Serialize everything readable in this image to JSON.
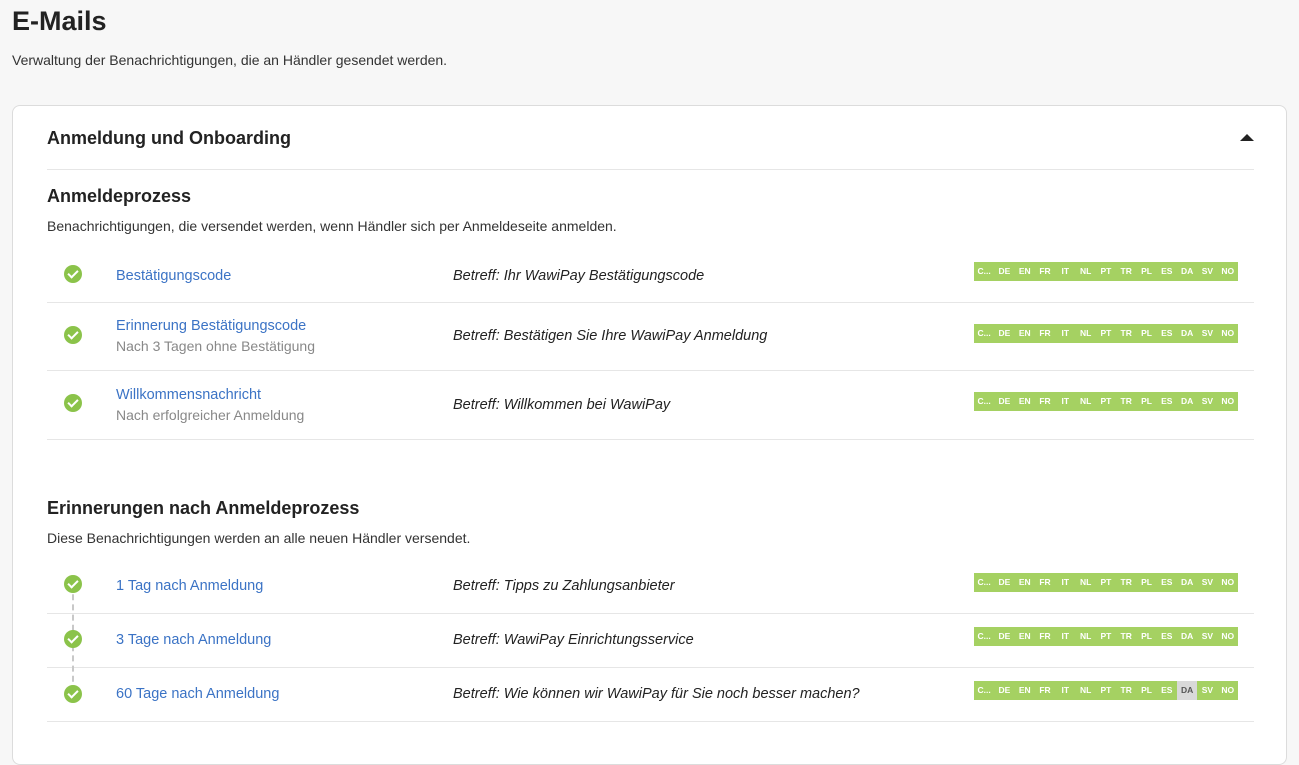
{
  "page": {
    "title": "E-Mails",
    "description": "Verwaltung der Benachrichtigungen, die an Händler gesendet werden."
  },
  "card": {
    "title": "Anmeldung und Onboarding",
    "collapse_icon": "caret-up-icon"
  },
  "colors": {
    "check": "#8bc34a",
    "lang_active": "#a5d162",
    "lang_inactive": "#d9d9d9",
    "link": "#3b73c5"
  },
  "sections": [
    {
      "title": "Anmeldeprozess",
      "description": "Benachrichtigungen, die versendet werden, wenn Händler sich per Anmeldeseite anmelden.",
      "rows": [
        {
          "name": "Bestätigungscode",
          "sub": "",
          "subject": "Betreff: Ihr WawiPay Bestätigungscode",
          "langs": [
            {
              "code": "C...",
              "active": true
            },
            {
              "code": "DE",
              "active": true
            },
            {
              "code": "EN",
              "active": true
            },
            {
              "code": "FR",
              "active": true
            },
            {
              "code": "IT",
              "active": true
            },
            {
              "code": "NL",
              "active": true
            },
            {
              "code": "PT",
              "active": true
            },
            {
              "code": "TR",
              "active": true
            },
            {
              "code": "PL",
              "active": true
            },
            {
              "code": "ES",
              "active": true
            },
            {
              "code": "DA",
              "active": true
            },
            {
              "code": "SV",
              "active": true
            },
            {
              "code": "NO",
              "active": true
            }
          ]
        },
        {
          "name": "Erinnerung Bestätigungscode",
          "sub": "Nach 3 Tagen ohne Bestätigung",
          "subject": "Betreff: Bestätigen Sie Ihre WawiPay Anmeldung",
          "langs": [
            {
              "code": "C...",
              "active": true
            },
            {
              "code": "DE",
              "active": true
            },
            {
              "code": "EN",
              "active": true
            },
            {
              "code": "FR",
              "active": true
            },
            {
              "code": "IT",
              "active": true
            },
            {
              "code": "NL",
              "active": true
            },
            {
              "code": "PT",
              "active": true
            },
            {
              "code": "TR",
              "active": true
            },
            {
              "code": "PL",
              "active": true
            },
            {
              "code": "ES",
              "active": true
            },
            {
              "code": "DA",
              "active": true
            },
            {
              "code": "SV",
              "active": true
            },
            {
              "code": "NO",
              "active": true
            }
          ]
        },
        {
          "name": "Willkommensnachricht",
          "sub": "Nach erfolgreicher Anmeldung",
          "subject": "Betreff: Willkommen bei WawiPay",
          "langs": [
            {
              "code": "C...",
              "active": true
            },
            {
              "code": "DE",
              "active": true
            },
            {
              "code": "EN",
              "active": true
            },
            {
              "code": "FR",
              "active": true
            },
            {
              "code": "IT",
              "active": true
            },
            {
              "code": "NL",
              "active": true
            },
            {
              "code": "PT",
              "active": true
            },
            {
              "code": "TR",
              "active": true
            },
            {
              "code": "PL",
              "active": true
            },
            {
              "code": "ES",
              "active": true
            },
            {
              "code": "DA",
              "active": true
            },
            {
              "code": "SV",
              "active": true
            },
            {
              "code": "NO",
              "active": true
            }
          ]
        }
      ]
    },
    {
      "title": "Erinnerungen nach Anmeldeprozess",
      "description": "Diese Benachrichtigungen werden an alle neuen Händler versendet.",
      "rows": [
        {
          "name": "1 Tag nach Anmeldung",
          "sub": "",
          "subject": "Betreff: Tipps zu Zahlungsanbieter",
          "langs": [
            {
              "code": "C...",
              "active": true
            },
            {
              "code": "DE",
              "active": true
            },
            {
              "code": "EN",
              "active": true
            },
            {
              "code": "FR",
              "active": true
            },
            {
              "code": "IT",
              "active": true
            },
            {
              "code": "NL",
              "active": true
            },
            {
              "code": "PT",
              "active": true
            },
            {
              "code": "TR",
              "active": true
            },
            {
              "code": "PL",
              "active": true
            },
            {
              "code": "ES",
              "active": true
            },
            {
              "code": "DA",
              "active": true
            },
            {
              "code": "SV",
              "active": true
            },
            {
              "code": "NO",
              "active": true
            }
          ]
        },
        {
          "name": "3 Tage nach Anmeldung",
          "sub": "",
          "subject": "Betreff: WawiPay Einrichtungsservice",
          "langs": [
            {
              "code": "C...",
              "active": true
            },
            {
              "code": "DE",
              "active": true
            },
            {
              "code": "EN",
              "active": true
            },
            {
              "code": "FR",
              "active": true
            },
            {
              "code": "IT",
              "active": true
            },
            {
              "code": "NL",
              "active": true
            },
            {
              "code": "PT",
              "active": true
            },
            {
              "code": "TR",
              "active": true
            },
            {
              "code": "PL",
              "active": true
            },
            {
              "code": "ES",
              "active": true
            },
            {
              "code": "DA",
              "active": true
            },
            {
              "code": "SV",
              "active": true
            },
            {
              "code": "NO",
              "active": true
            }
          ]
        },
        {
          "name": "60 Tage nach Anmeldung",
          "sub": "",
          "subject": "Betreff: Wie können wir WawiPay für Sie noch besser machen?",
          "langs": [
            {
              "code": "C...",
              "active": true
            },
            {
              "code": "DE",
              "active": true
            },
            {
              "code": "EN",
              "active": true
            },
            {
              "code": "FR",
              "active": true
            },
            {
              "code": "IT",
              "active": true
            },
            {
              "code": "NL",
              "active": true
            },
            {
              "code": "PT",
              "active": true
            },
            {
              "code": "TR",
              "active": true
            },
            {
              "code": "PL",
              "active": true
            },
            {
              "code": "ES",
              "active": true
            },
            {
              "code": "DA",
              "active": false
            },
            {
              "code": "SV",
              "active": true
            },
            {
              "code": "NO",
              "active": true
            }
          ]
        }
      ]
    }
  ]
}
